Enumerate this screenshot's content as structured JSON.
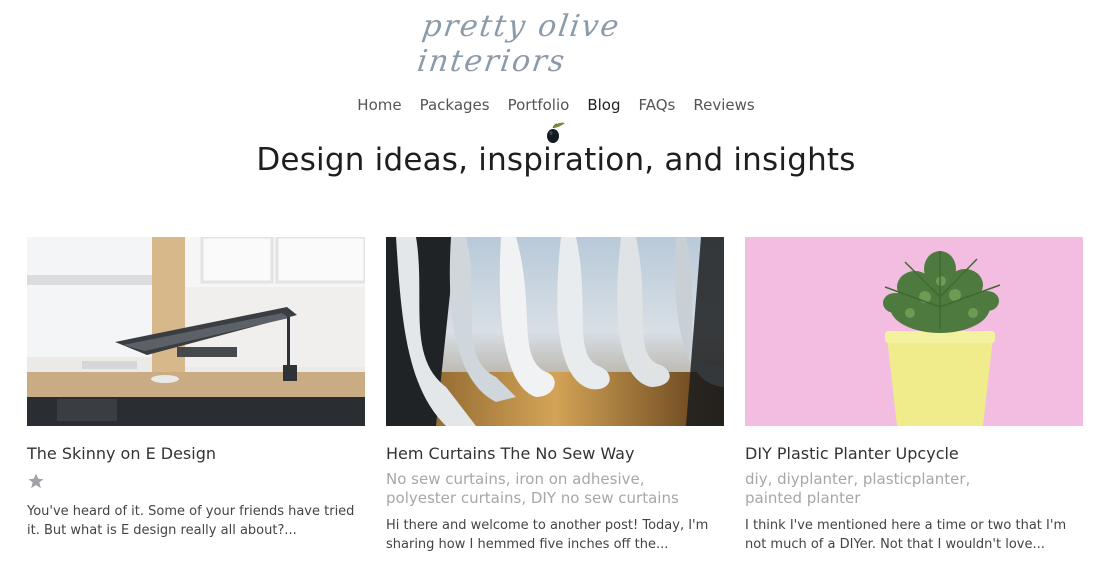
{
  "logo_text": "pretty olive interiors",
  "nav": {
    "items": [
      {
        "label": "Home",
        "active": false
      },
      {
        "label": "Packages",
        "active": false
      },
      {
        "label": "Portfolio",
        "active": false
      },
      {
        "label": "Blog",
        "active": true
      },
      {
        "label": "FAQs",
        "active": false
      },
      {
        "label": "Reviews",
        "active": false
      }
    ]
  },
  "heading": "Design ideas, inspiration, and insights",
  "posts": [
    {
      "title": "The Skinny on E Design",
      "tags": "",
      "excerpt_line1": "You've heard of it. Some of your friends have tried",
      "excerpt_line2": "it. But what is E design really all about?..."
    },
    {
      "title": "Hem Curtains The No Sew Way",
      "tags_line1": "No sew curtains, iron on adhesive,",
      "tags_line2": "polyester curtains, DIY no sew curtains",
      "excerpt_line1": "Hi there and welcome to another post! Today, I'm",
      "excerpt_line2": "sharing how I hemmed five inches off the..."
    },
    {
      "title": "DIY Plastic Planter Upcycle",
      "tags_line1": "diy, diyplanter, plasticplanter,",
      "tags_line2": "painted planter",
      "excerpt_line1": "I think I've mentioned here a time or two that I'm",
      "excerpt_line2": "not much of a DIYer. Not that I wouldn't love..."
    }
  ],
  "colors": {
    "accent": "#8c9ba9",
    "tag_text": "#a7a7a7",
    "star": "#a0a4a8"
  },
  "icons": {
    "olive": "olive-icon",
    "star": "star-icon"
  }
}
